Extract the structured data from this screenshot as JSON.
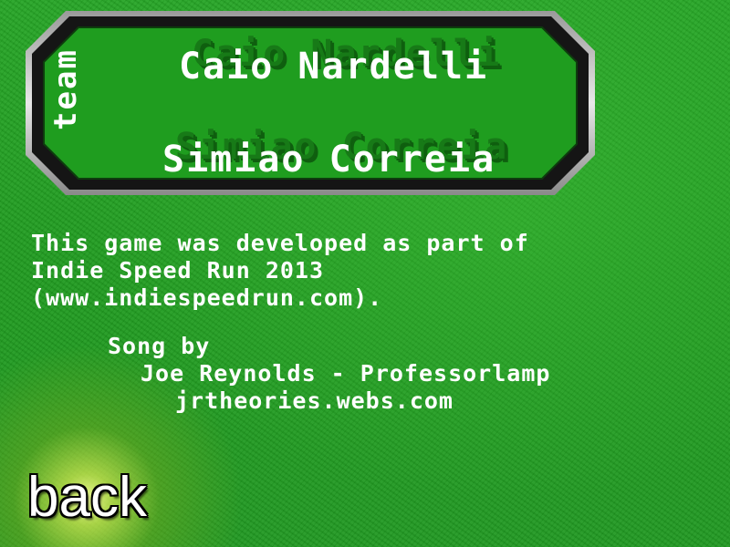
{
  "team": {
    "label": "team",
    "members": [
      "Caio Nardelli",
      "Simiao Correia"
    ]
  },
  "credits": {
    "lines": [
      "This game was developed as part of",
      "Indie Speed Run 2013",
      "(www.indiespeedrun.com)."
    ],
    "song_label": "Song by",
    "song_artist": "Joe Reynolds - Professorlamp",
    "song_site": "jrtheories.webs.com"
  },
  "navigation": {
    "back_label": "back"
  },
  "colors": {
    "background": "#1f9a1f",
    "text": "#ffffff",
    "plate_fill": "#1e9a1e",
    "plate_border": "#111111"
  }
}
